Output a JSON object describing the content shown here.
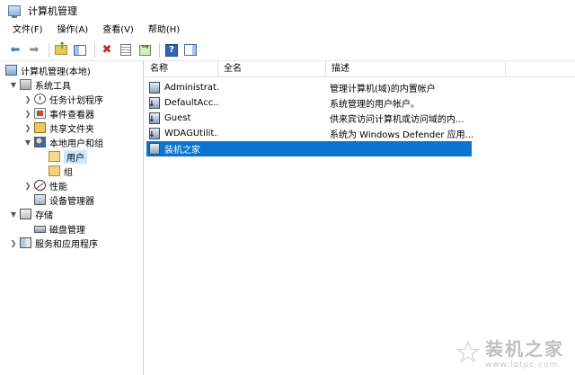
{
  "window": {
    "title": "计算机管理"
  },
  "menu": [
    "文件(F)",
    "操作(A)",
    "查看(V)",
    "帮助(H)"
  ],
  "toolbar": {
    "back_icon": "arrow-left-icon",
    "forward_icon": "arrow-right-icon",
    "up_icon": "folder-up-icon",
    "tree_icon": "show-tree-icon",
    "delete_icon": "delete-icon",
    "properties_icon": "properties-icon",
    "export_icon": "export-icon",
    "help_label": "?",
    "pane_icon": "action-pane-icon"
  },
  "tree": {
    "root": "计算机管理(本地)",
    "system_tools": "系统工具",
    "task_scheduler": "任务计划程序",
    "event_viewer": "事件查看器",
    "shared_folders": "共享文件夹",
    "local_users_groups": "本地用户和组",
    "users": "用户",
    "groups": "组",
    "performance": "性能",
    "device_manager": "设备管理器",
    "storage": "存储",
    "disk_management": "磁盘管理",
    "services_apps": "服务和应用程序"
  },
  "list": {
    "columns": [
      "名称",
      "全名",
      "描述"
    ],
    "rows": [
      {
        "name": "Administrat...",
        "fullname": "",
        "desc": "管理计算机(域)的内置帐户",
        "disabled": false
      },
      {
        "name": "DefaultAcc...",
        "fullname": "",
        "desc": "系统管理的用户帐户。",
        "disabled": true
      },
      {
        "name": "Guest",
        "fullname": "",
        "desc": "供来宾访问计算机或访问域的内...",
        "disabled": true
      },
      {
        "name": "WDAGUtilit...",
        "fullname": "",
        "desc": "系统为 Windows Defender 应用...",
        "disabled": true
      },
      {
        "name": "装机之家",
        "fullname": "",
        "desc": "",
        "disabled": false,
        "selected": true
      }
    ]
  },
  "watermark": {
    "name": "装机之家",
    "url": "www.lotpc.com"
  },
  "colors": {
    "selection": "#0a75d1",
    "tree_selection": "#cce8ff"
  }
}
